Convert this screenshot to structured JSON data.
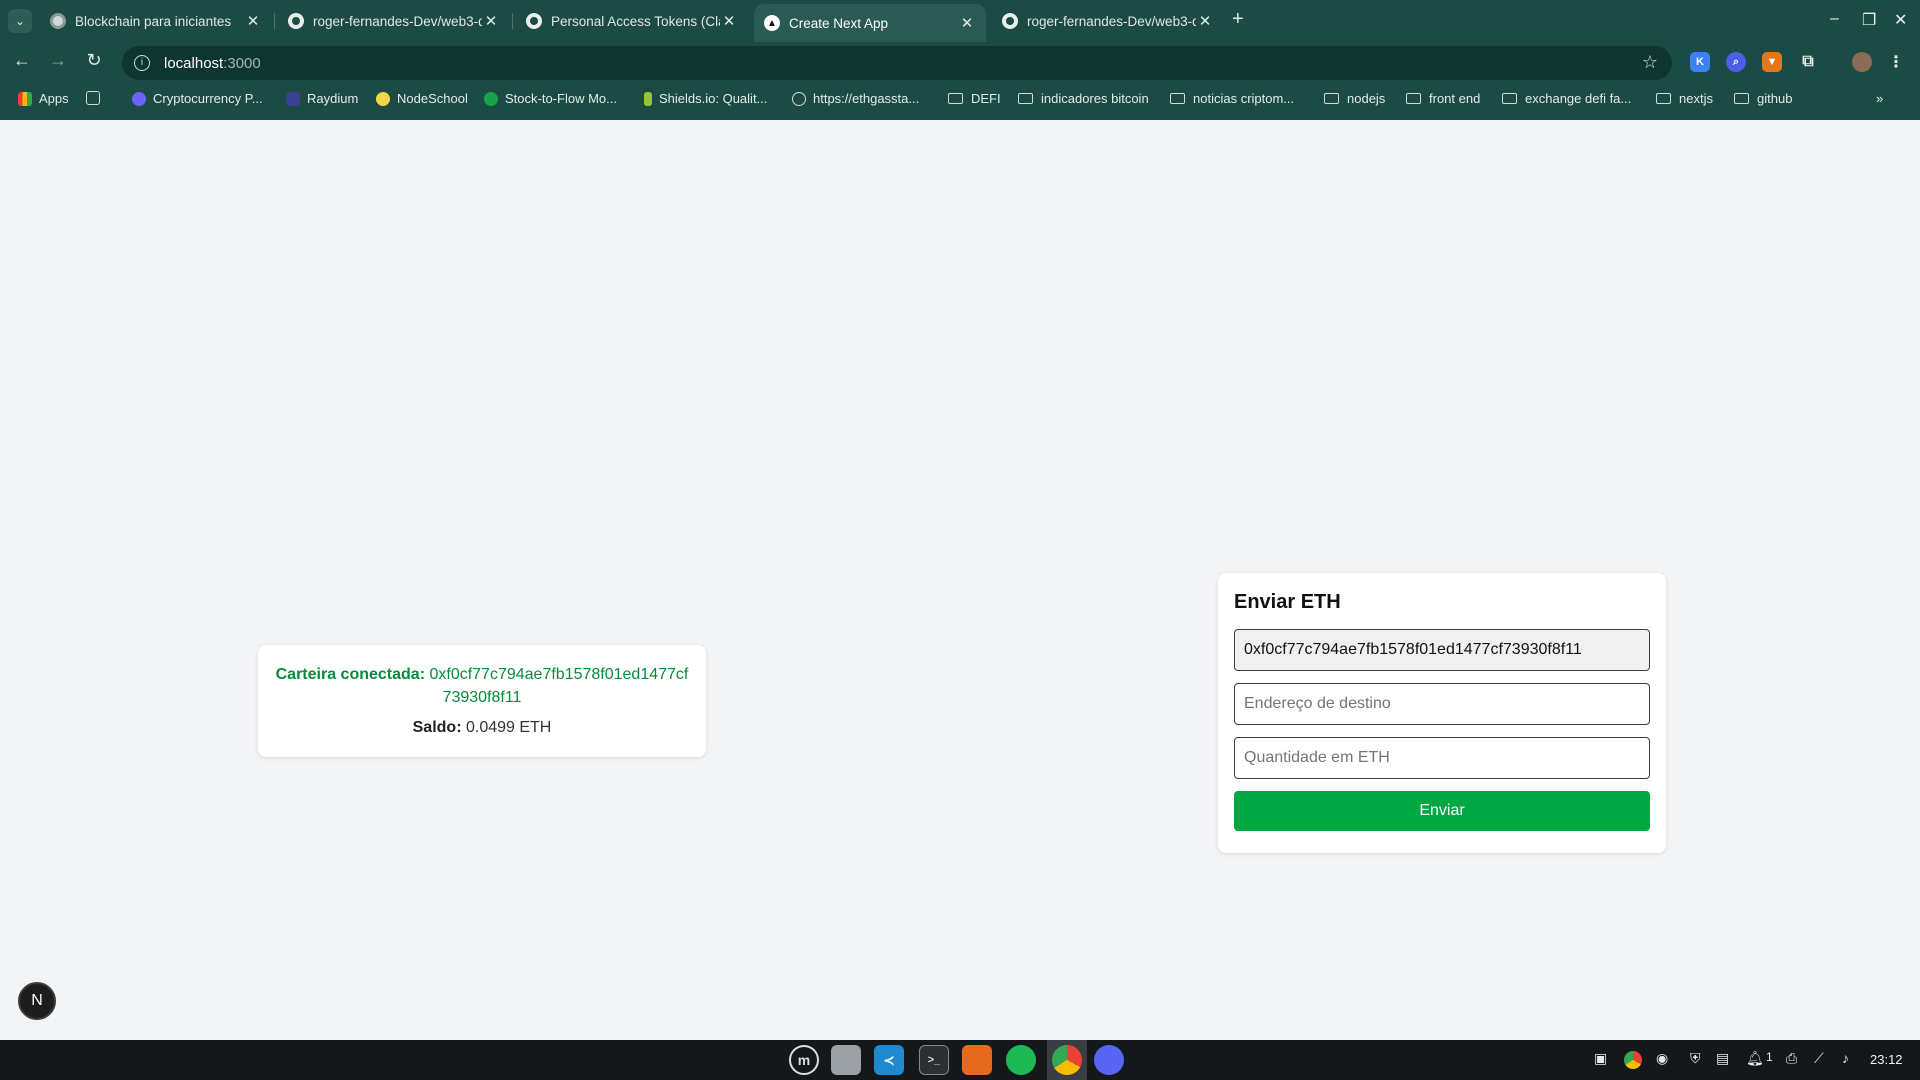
{
  "tabs": [
    {
      "title": "Blockchain para iniciantes"
    },
    {
      "title": "roger-fernandes-Dev/web3-d"
    },
    {
      "title": "Personal Access Tokens (Clas"
    },
    {
      "title": "Create Next App"
    },
    {
      "title": "roger-fernandes-Dev/web3-d"
    }
  ],
  "address_bar": {
    "host": "localhost",
    "port": ":3000"
  },
  "bookmarks": [
    {
      "label": "Apps"
    },
    {
      "label": "Cryptocurrency P..."
    },
    {
      "label": "Raydium"
    },
    {
      "label": "NodeSchool"
    },
    {
      "label": "Stock-to-Flow Mo..."
    },
    {
      "label": "Shields.io: Qualit..."
    },
    {
      "label": "https://ethgassta..."
    },
    {
      "label": "DEFI"
    },
    {
      "label": "indicadores bitcoin"
    },
    {
      "label": "noticias criptom..."
    },
    {
      "label": "nodejs"
    },
    {
      "label": "front end"
    },
    {
      "label": "exchange defi fa..."
    },
    {
      "label": "nextjs"
    },
    {
      "label": "github"
    }
  ],
  "wallet": {
    "label": "Carteira conectada:",
    "address": "0xf0cf77c794ae7fb1578f01ed1477cf73930f8f11",
    "balance_label": "Saldo:",
    "balance_value": "0.0499 ETH"
  },
  "send_form": {
    "title": "Enviar ETH",
    "from_value": "0xf0cf77c794ae7fb1578f01ed1477cf73930f8f11",
    "destination_placeholder": "Endereço de destino",
    "amount_placeholder": "Quantidade em ETH",
    "button_label": "Enviar"
  },
  "next_badge": "N",
  "taskbar": {
    "clock": "23:12",
    "notification_count": "1"
  },
  "colors": {
    "chrome": "#1c4a45",
    "accent_green": "#00a743",
    "wallet_green": "#0a8a3b"
  }
}
